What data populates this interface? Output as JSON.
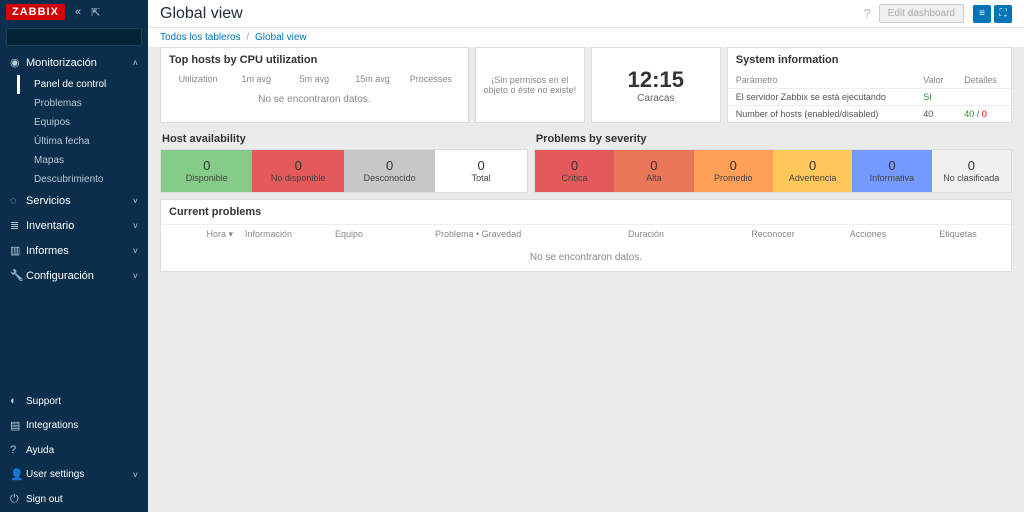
{
  "brand": "ZABBIX",
  "search": {
    "placeholder": ""
  },
  "sidebar": {
    "sections": [
      {
        "icon": "◉",
        "label": "Monitorización",
        "open": true,
        "items": [
          "Panel de control",
          "Problemas",
          "Equipos",
          "Última fecha",
          "Mapas",
          "Descubrimiento"
        ],
        "active": 0
      },
      {
        "icon": "◌",
        "label": "Servicios"
      },
      {
        "icon": "≣",
        "label": "Inventario"
      },
      {
        "icon": "▥",
        "label": "Informes"
      },
      {
        "icon": "🔧",
        "label": "Configuración"
      }
    ],
    "bottom": [
      {
        "icon": "◐",
        "label": "Support"
      },
      {
        "icon": "▤",
        "label": "Integrations"
      },
      {
        "icon": "?",
        "label": "Ayuda"
      },
      {
        "icon": "👤",
        "label": "User settings"
      },
      {
        "icon": "⏻",
        "label": "Sign out"
      }
    ]
  },
  "header": {
    "title": "Global view",
    "edit": "Edit dashboard"
  },
  "crumbs": {
    "all": "Todos los tableros",
    "current": "Global view"
  },
  "cpu": {
    "title": "Top hosts by CPU utilization",
    "cols": [
      "Utilization",
      "1m avg",
      "5m avg",
      "15m avg",
      "Processes"
    ],
    "empty": "No se encontraron datos."
  },
  "perm": "¡Sin permisos en el objeto o éste no existe!",
  "clock": {
    "time": "12:15",
    "tz": "Caracas"
  },
  "sys": {
    "title": "System information",
    "headers": [
      "Parámetro",
      "Valor",
      "Detalles"
    ],
    "rows": [
      {
        "p": "El servidor Zabbix se está ejecutando",
        "v": "Sí",
        "d": "",
        "vclass": "green"
      },
      {
        "p": "Number of hosts (enabled/disabled)",
        "v": "40",
        "d": "40 / 0",
        "dclass": "mix"
      }
    ]
  },
  "avail": {
    "title": "Host availability",
    "tiles": [
      {
        "n": "0",
        "t": "Disponible",
        "cls": "green"
      },
      {
        "n": "0",
        "t": "No disponible",
        "cls": "red"
      },
      {
        "n": "0",
        "t": "Desconocido",
        "cls": "gray"
      },
      {
        "n": "0",
        "t": "Total",
        "cls": "plain"
      }
    ]
  },
  "sev": {
    "title": "Problems by severity",
    "tiles": [
      {
        "n": "0",
        "t": "Crítica",
        "cls": "crit"
      },
      {
        "n": "0",
        "t": "Alta",
        "cls": "high"
      },
      {
        "n": "0",
        "t": "Promedio",
        "cls": "avg"
      },
      {
        "n": "0",
        "t": "Advertencia",
        "cls": "warn"
      },
      {
        "n": "0",
        "t": "Informativa",
        "cls": "info"
      },
      {
        "n": "0",
        "t": "No clasificada",
        "cls": "na"
      }
    ]
  },
  "problems": {
    "title": "Current problems",
    "cols": {
      "hora": "Hora ▾",
      "info": "Información",
      "equipo": "Equipo",
      "pg": "Problema • Gravedad",
      "dur": "Duración",
      "rec": "Reconocer",
      "acc": "Acciones",
      "etq": "Etiquetas"
    },
    "empty": "No se encontraron datos."
  }
}
